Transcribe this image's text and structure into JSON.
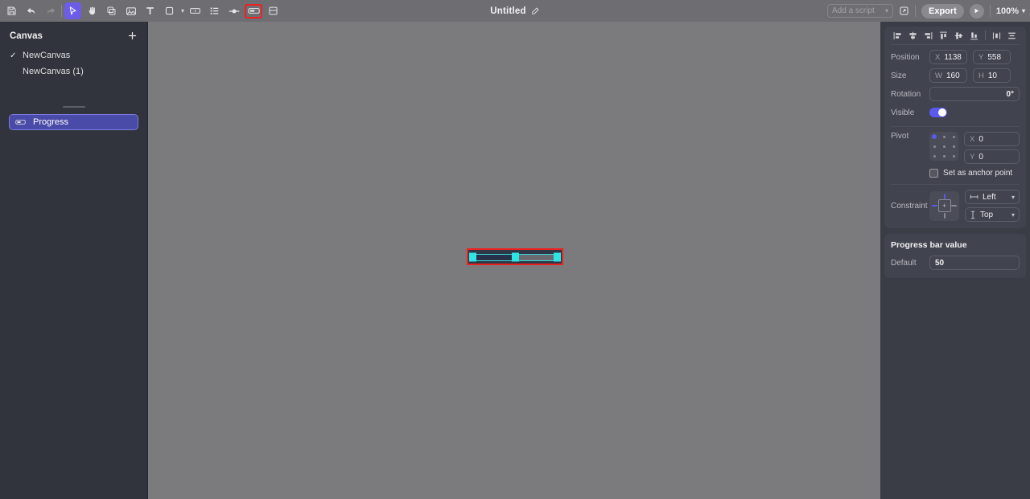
{
  "topbar": {
    "tools": [
      {
        "name": "save-icon",
        "label": "Save",
        "state": "normal"
      },
      {
        "name": "undo-icon",
        "label": "Undo",
        "state": "normal"
      },
      {
        "name": "redo-icon",
        "label": "Redo",
        "state": "dim"
      },
      {
        "name": "select-tool-icon",
        "label": "Select",
        "state": "active"
      },
      {
        "name": "hand-tool-icon",
        "label": "Hand",
        "state": "normal"
      },
      {
        "name": "frame-icon",
        "label": "Frame",
        "state": "normal"
      },
      {
        "name": "image-icon",
        "label": "Image",
        "state": "normal"
      },
      {
        "name": "text-icon",
        "label": "Text",
        "state": "normal"
      },
      {
        "name": "shape-icon",
        "label": "Shape",
        "state": "normal"
      },
      {
        "name": "button-icon",
        "label": "Button",
        "state": "normal"
      },
      {
        "name": "list-icon",
        "label": "List",
        "state": "normal"
      },
      {
        "name": "slider-icon",
        "label": "Slider",
        "state": "normal"
      },
      {
        "name": "progress-bar-icon",
        "label": "Progress Bar",
        "state": "highlight"
      },
      {
        "name": "container-icon",
        "label": "Container",
        "state": "normal"
      }
    ],
    "document_title": "Untitled",
    "edit_title_icon": "pencil-icon",
    "script_select": "Add a script",
    "open_external_icon": "external-link-icon",
    "export_label": "Export",
    "play_icon": "play-icon",
    "zoom_level": "100%"
  },
  "sidebar": {
    "title": "Canvas",
    "add_icon": "plus-icon",
    "canvases": [
      {
        "label": "NewCanvas",
        "checked": true
      },
      {
        "label": "NewCanvas (1)",
        "checked": false
      }
    ],
    "layers": [
      {
        "label": "Progress",
        "icon": "progress-bar-icon",
        "selected": true
      }
    ]
  },
  "canvas": {
    "selected_element": "progress-bar",
    "selection_color": "#ef2020",
    "handle_color": "#2ee4e4",
    "fill_color": "#29314a",
    "track_color": "#6a6a70",
    "progress_percent": 50
  },
  "inspector": {
    "align_icons": [
      "align-left-icon",
      "align-horizontal-center-icon",
      "align-right-icon",
      "align-top-icon",
      "align-vertical-center-icon",
      "align-bottom-icon",
      "distribute-horizontal-icon",
      "distribute-vertical-icon"
    ],
    "position": {
      "label": "Position",
      "x_axis": "X",
      "x_value": "1138",
      "y_axis": "Y",
      "y_value": "558"
    },
    "size": {
      "label": "Size",
      "w_axis": "W",
      "w_value": "160",
      "h_axis": "H",
      "h_value": "10"
    },
    "rotation": {
      "label": "Rotation",
      "value": "0°"
    },
    "visible": {
      "label": "Visible",
      "on": true
    },
    "pivot": {
      "label": "Pivot",
      "selected_index": 0,
      "x_axis": "X",
      "x_value": "0",
      "y_axis": "Y",
      "y_value": "0",
      "anchor_label": "Set as anchor point",
      "anchor_checked": false
    },
    "constraint": {
      "label": "Constraint",
      "horizontal": "Left",
      "horizontal_icon": "horizontal-constraint-icon",
      "vertical": "Top",
      "vertical_icon": "vertical-constraint-icon",
      "top_active": true,
      "left_active": true,
      "right_active": false,
      "bottom_active": false
    },
    "progress_value": {
      "title": "Progress bar value",
      "default_label": "Default",
      "default_value": "50"
    }
  }
}
